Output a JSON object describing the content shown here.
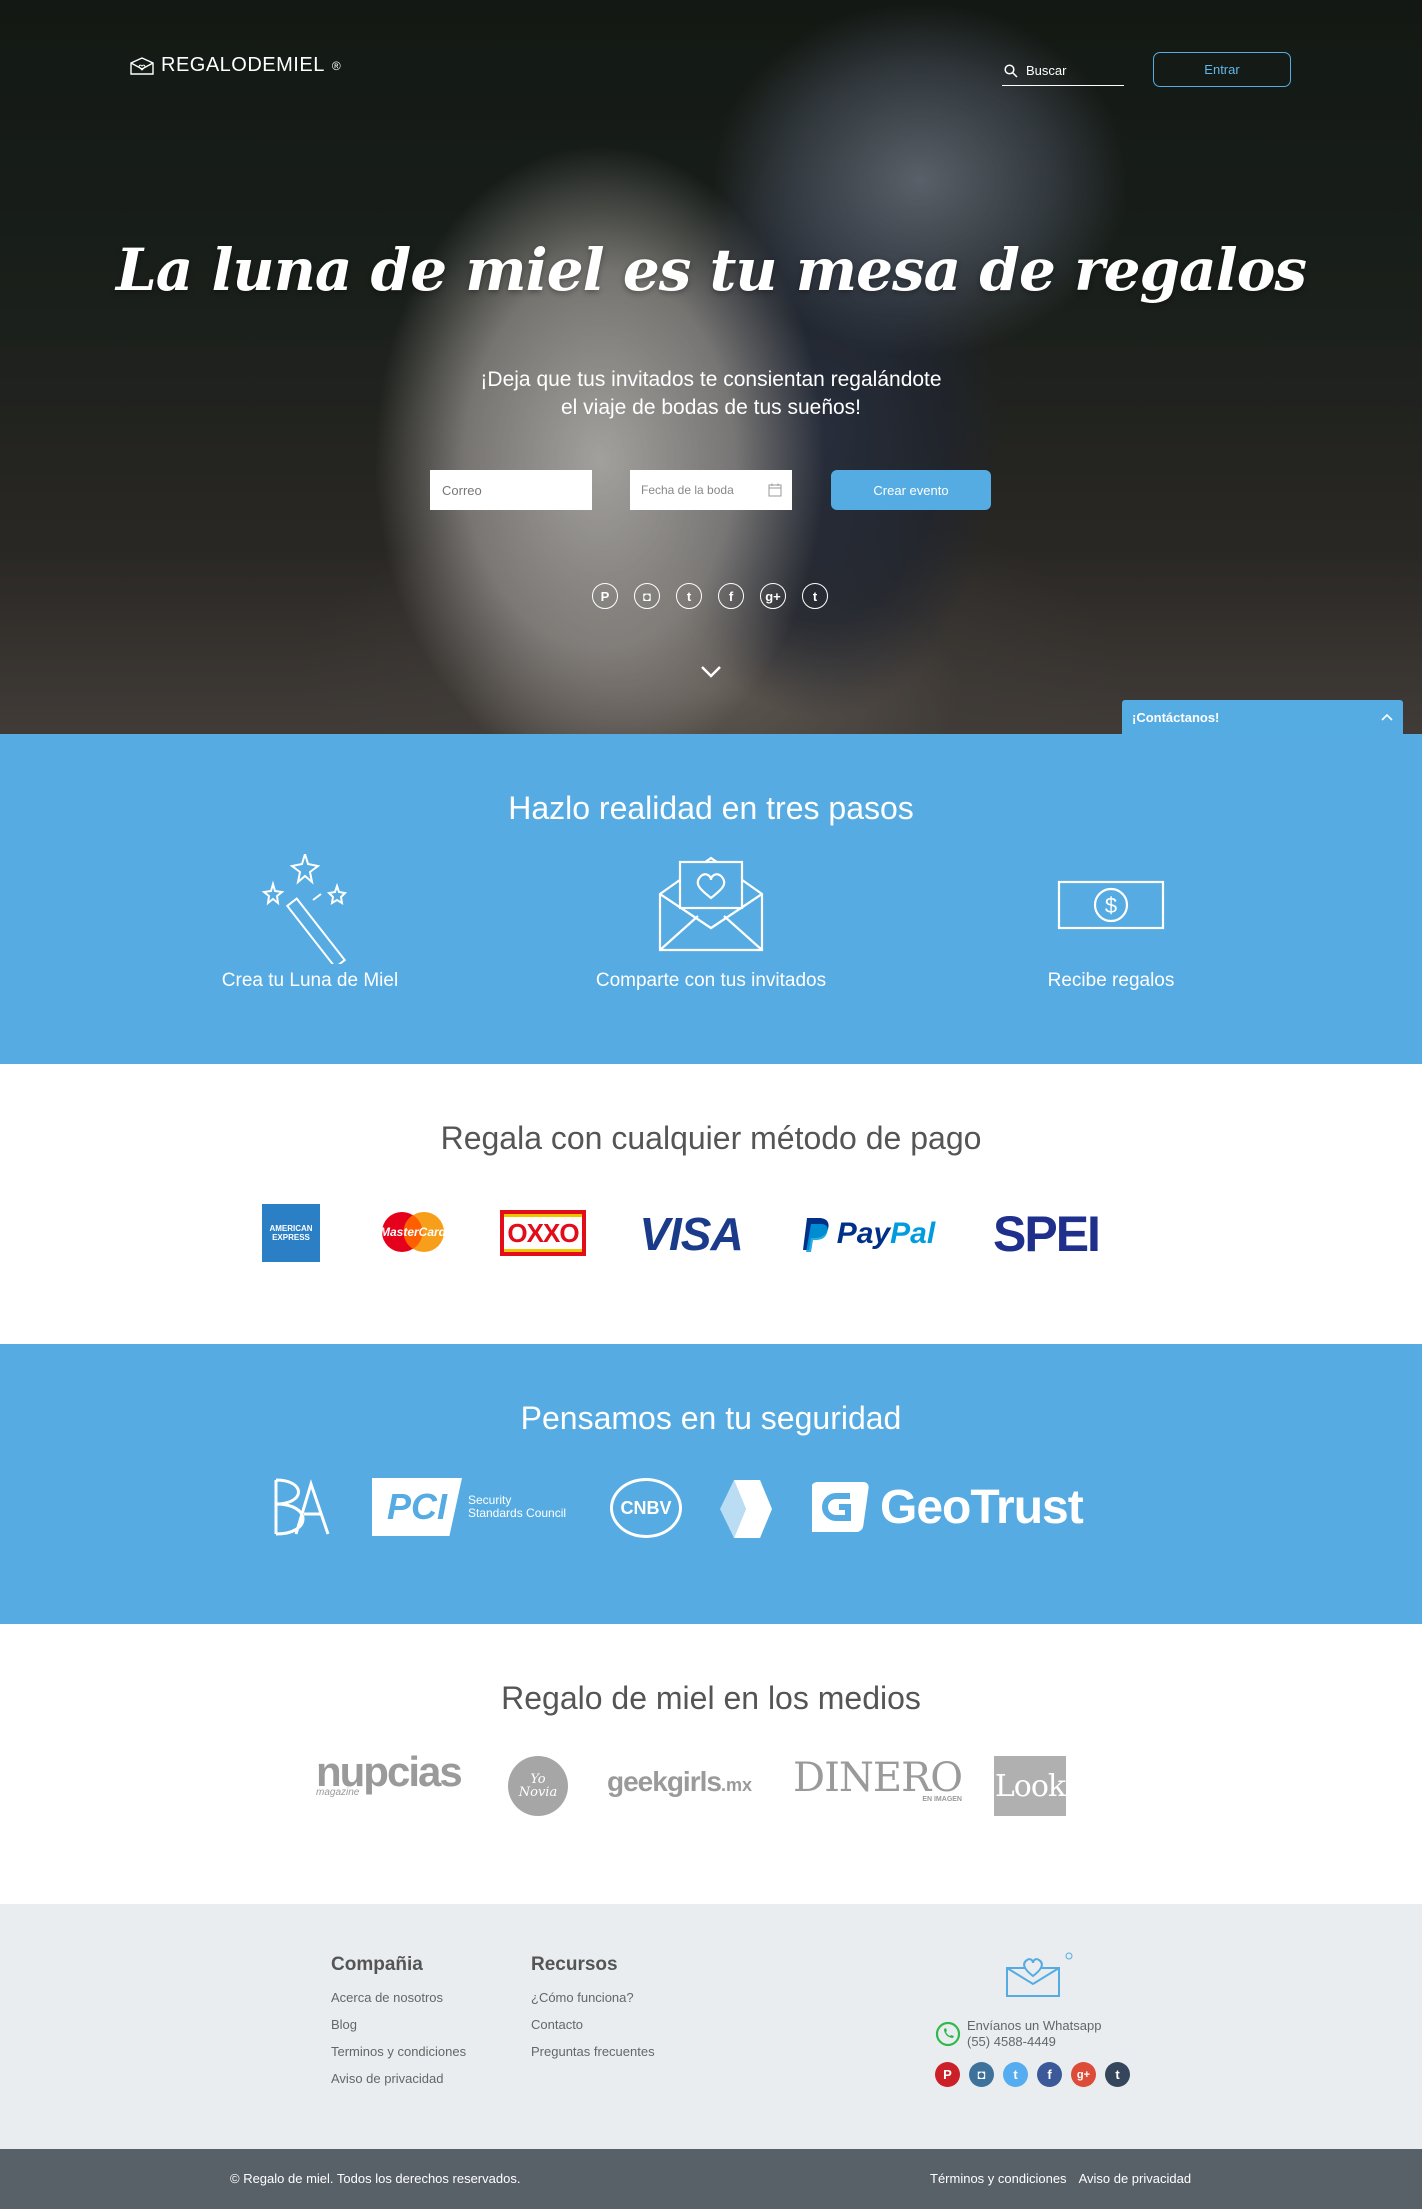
{
  "header": {
    "logo_text": "REGALODEMIEL",
    "logo_mark": "®",
    "search_placeholder": "Buscar",
    "login_label": "Entrar"
  },
  "hero": {
    "title": "La luna de miel es tu mesa de regalos",
    "subtitle_line1": "¡Deja que tus invitados te consientan regalándote",
    "subtitle_line2": "el viaje de bodas de tus sueños!",
    "email_placeholder": "Correo",
    "date_placeholder": "Fecha de la boda",
    "create_label": "Crear evento",
    "socials": [
      "pinterest-icon",
      "instagram-icon",
      "twitter-icon",
      "facebook-icon",
      "google-plus-icon",
      "tumblr-icon"
    ]
  },
  "contact_tab": {
    "label": "¡Contáctanos!"
  },
  "steps": {
    "title": "Hazlo realidad en tres pasos",
    "items": [
      {
        "label": "Crea tu Luna de Miel",
        "icon": "magic-wand-icon"
      },
      {
        "label": "Comparte con tus invitados",
        "icon": "heart-envelope-icon"
      },
      {
        "label": "Recibe regalos",
        "icon": "dollar-bill-icon"
      }
    ]
  },
  "payments": {
    "title": "Regala con cualquier método de pago",
    "logos": {
      "amex": "AMERICAN EXPRESS",
      "mastercard": "MasterCard",
      "oxxo": "OXXO",
      "visa": "VISA",
      "paypal_pay": "Pay",
      "paypal_pal": "Pal",
      "spei": "SPEI"
    }
  },
  "security": {
    "title": "Pensamos en tu seguridad",
    "logos": {
      "pci": "PCI",
      "pci_sub1": "Security",
      "pci_sub2": "Standards Council",
      "cnbv": "CNBV",
      "geotrust": "GeoTrust"
    }
  },
  "media": {
    "title": "Regalo de miel en los medios",
    "logos": {
      "nupcias": "nupcias",
      "nupcias_sub": "magazine",
      "yonovia": "Yo Novia",
      "geekgirls": "geekgirls",
      "geekgirls_tld": ".mx",
      "dinero": "DINERO",
      "dinero_sub": "EN IMAGEN",
      "look": "Look"
    }
  },
  "footer": {
    "company": {
      "title": "Compañia",
      "links": [
        "Acerca de nosotros",
        "Blog",
        "Terminos y condiciones",
        "Aviso de privacidad"
      ]
    },
    "resources": {
      "title": "Recursos",
      "links": [
        "¿Cómo funciona?",
        "Contacto",
        "Preguntas frecuentes"
      ]
    },
    "whatsapp_line1": "Envíanos un Whatsapp",
    "whatsapp_line2": "(55) 4588-4449",
    "copyright": "© Regalo de miel. Todos los derechos reservados.",
    "legal": {
      "terms": "Términos y condiciones",
      "privacy": "Aviso de privacidad"
    }
  },
  "colors": {
    "accent": "#55abe2",
    "footer_bg": "#e9edf0",
    "bottom_bar": "#586068"
  }
}
